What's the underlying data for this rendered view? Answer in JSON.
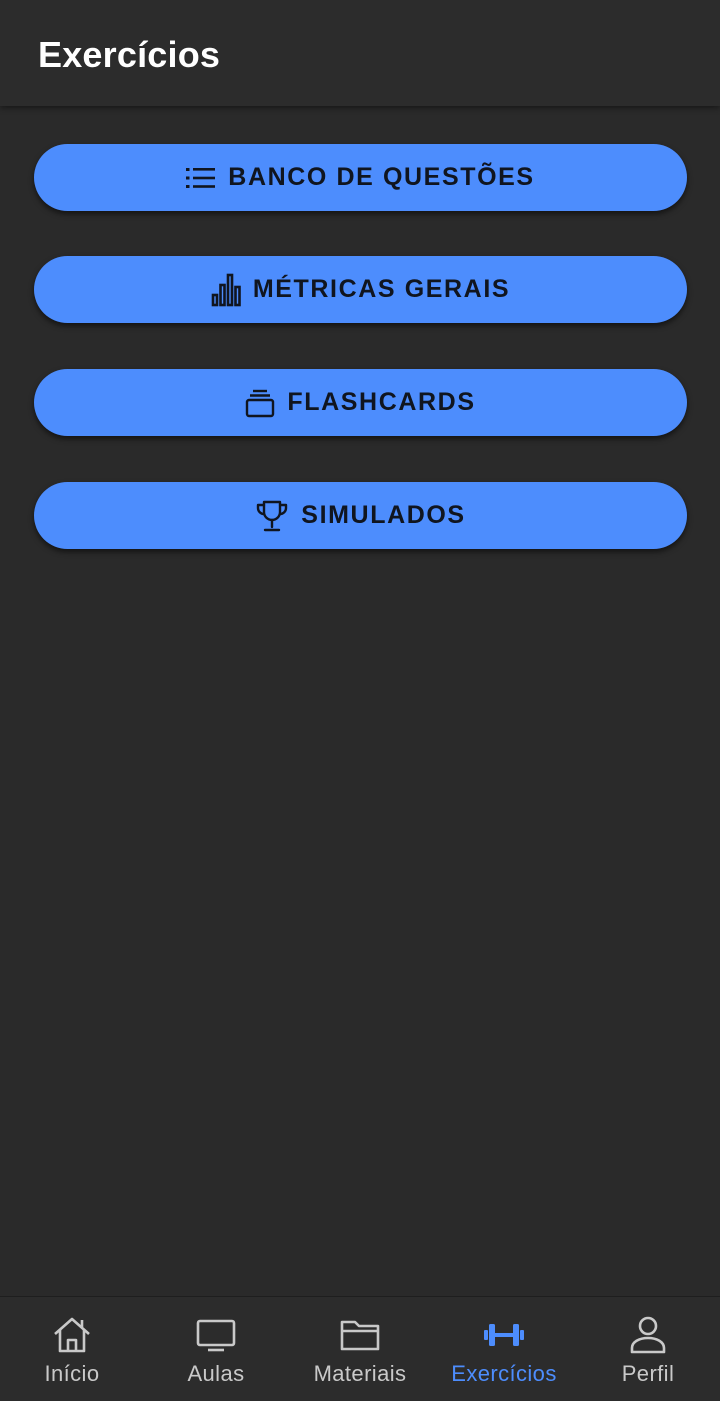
{
  "header": {
    "title": "Exercícios"
  },
  "menu": {
    "items": [
      {
        "label": "BANCO DE QUESTÕES",
        "icon": "list-icon"
      },
      {
        "label": "MÉTRICAS GERAIS",
        "icon": "bar-chart-icon"
      },
      {
        "label": "FLASHCARDS",
        "icon": "cards-stack-icon"
      },
      {
        "label": "SIMULADOS",
        "icon": "trophy-icon"
      }
    ]
  },
  "bottom_nav": {
    "active": "Exercícios",
    "items": [
      {
        "label": "Início",
        "icon": "home-icon"
      },
      {
        "label": "Aulas",
        "icon": "tv-icon"
      },
      {
        "label": "Materiais",
        "icon": "folder-icon"
      },
      {
        "label": "Exercícios",
        "icon": "dumbbell-icon"
      },
      {
        "label": "Perfil",
        "icon": "person-icon"
      }
    ]
  },
  "colors": {
    "background": "#2a2a2a",
    "bar": "#2c2c2c",
    "accent": "#4d8dfd",
    "button_text": "#10151f",
    "nav_text": "#c9c9c9"
  }
}
